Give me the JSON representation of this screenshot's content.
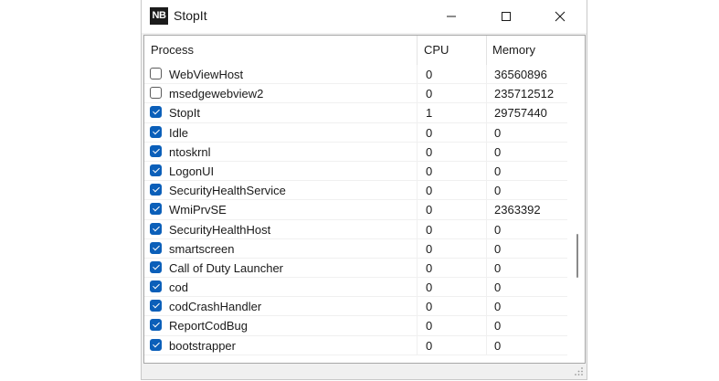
{
  "window": {
    "app_icon_text": "NB",
    "title": "StopIt",
    "controls": {
      "minimize": "minimize",
      "maximize": "maximize",
      "close": "close"
    }
  },
  "table": {
    "columns": [
      "Process",
      "CPU",
      "Memory"
    ],
    "rows": [
      {
        "checked": false,
        "name": "WebViewHost",
        "cpu": "0",
        "memory": "36560896"
      },
      {
        "checked": false,
        "name": "msedgewebview2",
        "cpu": "0",
        "memory": "235712512"
      },
      {
        "checked": true,
        "name": "StopIt",
        "cpu": "1",
        "memory": "29757440"
      },
      {
        "checked": true,
        "name": "Idle",
        "cpu": "0",
        "memory": "0"
      },
      {
        "checked": true,
        "name": "ntoskrnl",
        "cpu": "0",
        "memory": "0"
      },
      {
        "checked": true,
        "name": "LogonUI",
        "cpu": "0",
        "memory": "0"
      },
      {
        "checked": true,
        "name": "SecurityHealthService",
        "cpu": "0",
        "memory": "0"
      },
      {
        "checked": true,
        "name": "WmiPrvSE",
        "cpu": "0",
        "memory": "2363392"
      },
      {
        "checked": true,
        "name": "SecurityHealthHost",
        "cpu": "0",
        "memory": "0"
      },
      {
        "checked": true,
        "name": "smartscreen",
        "cpu": "0",
        "memory": "0"
      },
      {
        "checked": true,
        "name": "Call of Duty Launcher",
        "cpu": "0",
        "memory": "0"
      },
      {
        "checked": true,
        "name": "cod",
        "cpu": "0",
        "memory": "0"
      },
      {
        "checked": true,
        "name": "codCrashHandler",
        "cpu": "0",
        "memory": "0"
      },
      {
        "checked": true,
        "name": "ReportCodBug",
        "cpu": "0",
        "memory": "0"
      },
      {
        "checked": true,
        "name": "bootstrapper",
        "cpu": "0",
        "memory": "0"
      }
    ]
  },
  "colors": {
    "accent": "#0b5fb9",
    "window_bg": "#f0f0f0",
    "list_bg": "#ffffff"
  }
}
